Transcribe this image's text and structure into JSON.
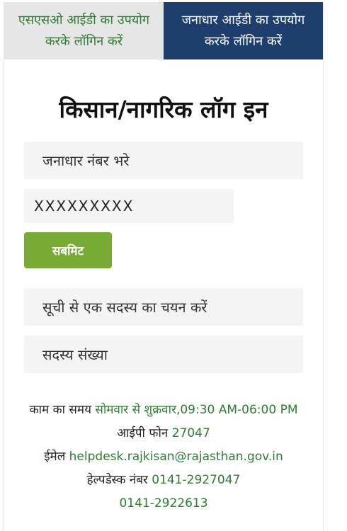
{
  "tabs": {
    "sso": "एसएसओ आईडी का उपयोग करके लॉगिन करें",
    "janaadhaar": "जनाधार आईडी का उपयोग करके लॉगिन करें"
  },
  "login": {
    "title": "किसान/नागरिक लॉग इन",
    "janaadhaar_placeholder": "जनाधार नंबर भरे",
    "janaadhaar_value": "XXXXXXXXX",
    "submit_label": "सबमिट",
    "member_select": "सूची से एक सदस्य का चयन करें",
    "member_count_placeholder": "सदस्य संख्या"
  },
  "info": {
    "hours_label": "काम का समय",
    "hours_days": "सोमवार से शुक्रवार",
    "hours_time": ",09:30 AM-06:00 PM",
    "ip_phone_label": "आईपी फोन",
    "ip_phone_value": "27047",
    "email_label": "ईमेल",
    "email_value": "helpdesk.rajkisan@rajasthan.gov.in",
    "helpdesk_label": "हेल्पडेस्क नंबर",
    "helpdesk_value_1": "0141-2927047",
    "helpdesk_value_2": "0141-2922613"
  },
  "colors": {
    "tab_active_bg": "#1e3f6e",
    "tab_inactive_bg": "#e6e6e6",
    "accent_green": "#2e7d32",
    "submit_bg": "#78aa36"
  }
}
